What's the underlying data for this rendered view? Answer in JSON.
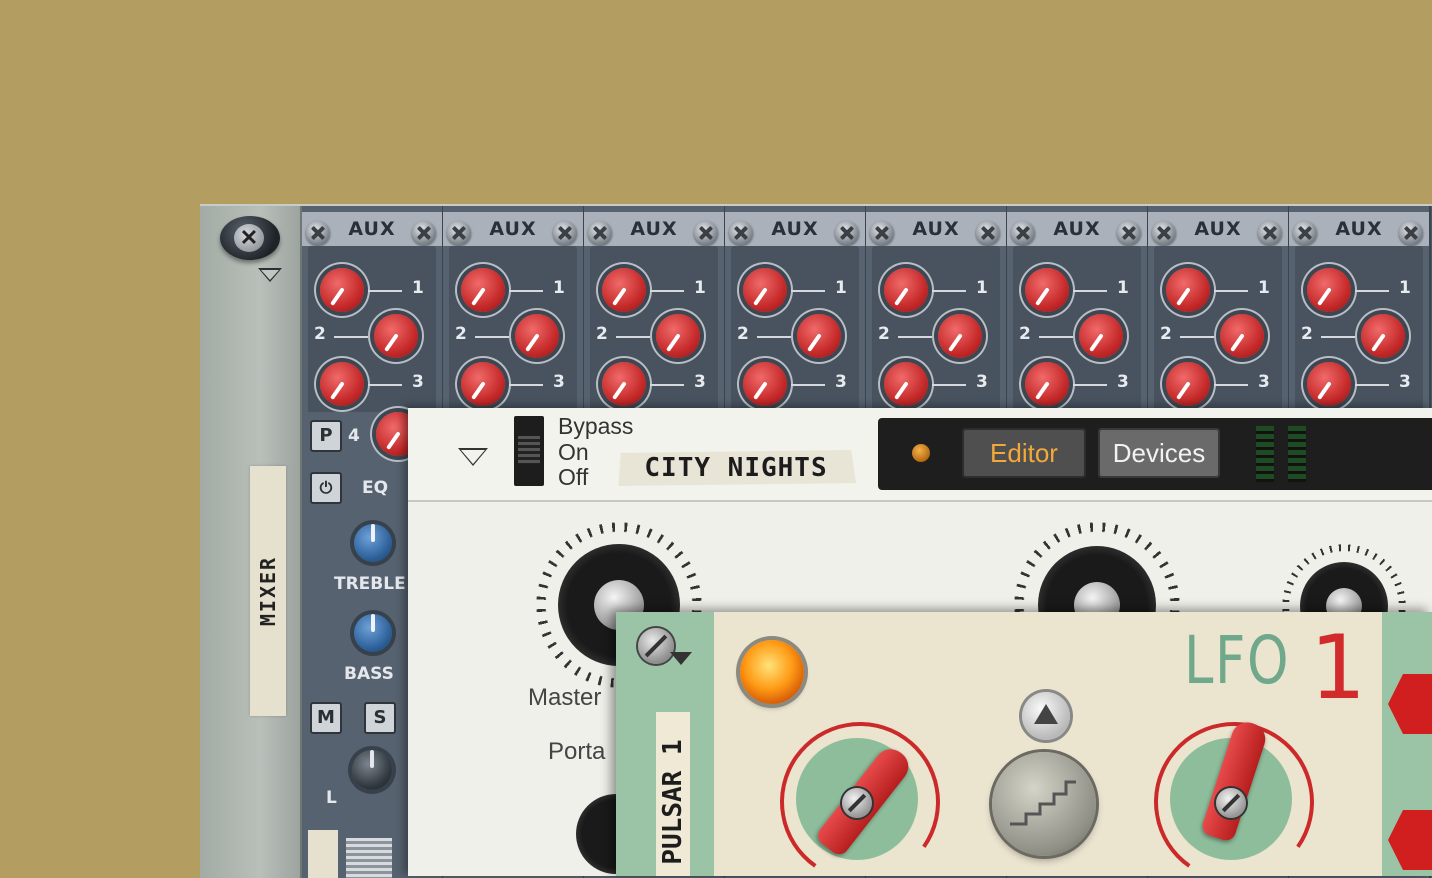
{
  "mixer": {
    "label": "MIXER",
    "aux_label": "AUX",
    "send_numbers": [
      "1",
      "2",
      "3",
      "4"
    ],
    "channel_buttons": {
      "p": "P",
      "m": "M",
      "s": "S"
    },
    "eq": {
      "label": "EQ",
      "treble": "TREBLE",
      "bass": "BASS",
      "pan_left": "L"
    },
    "colors": {
      "send_knob": "#c62a2a",
      "eq_knob": "#2c5f98",
      "panel": "#56626f"
    }
  },
  "instrument": {
    "bypass_labels": [
      "Bypass",
      "On",
      "Off"
    ],
    "patch_name": "CITY NIGHTS",
    "tabs": [
      {
        "label": "Editor",
        "active": true
      },
      {
        "label": "Devices",
        "active": false
      }
    ],
    "knob_labels": {
      "master": "Master",
      "porta": "Porta"
    },
    "colors": {
      "active_tab_text": "#f2a93a"
    }
  },
  "pulsar": {
    "label": "PULSAR 1",
    "lfo_title": "LFO",
    "lfo_number": "1",
    "colors": {
      "accent_red": "#d12b2b",
      "accent_green": "#6fa88a"
    }
  }
}
